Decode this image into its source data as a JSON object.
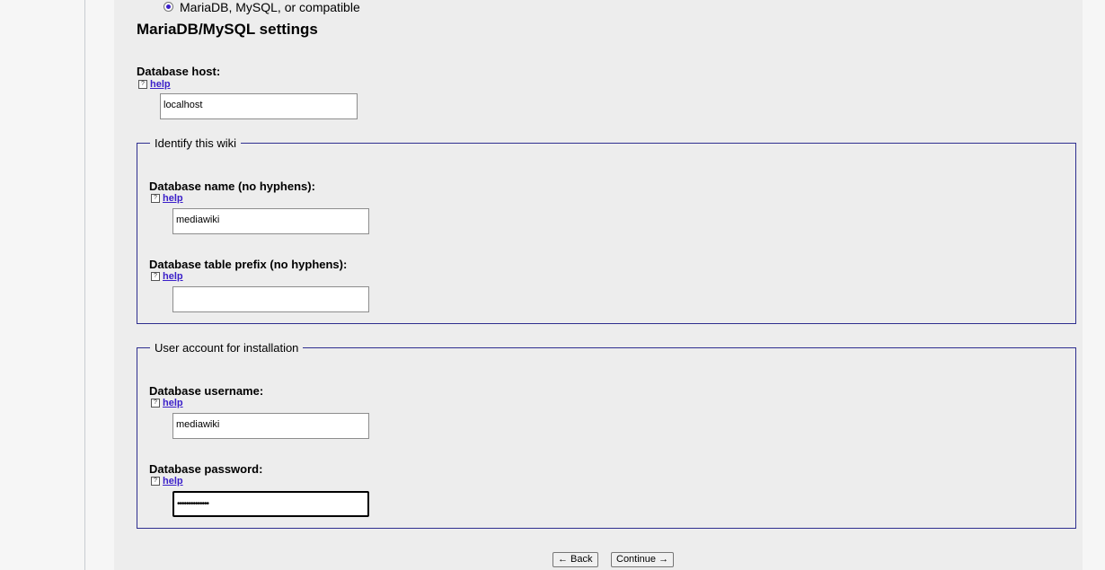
{
  "db_type": {
    "selected_option": "MariaDB, MySQL, or compatible"
  },
  "section_title": "MariaDB/MySQL settings",
  "db_host": {
    "label": "Database host:",
    "help": "help",
    "value": "localhost"
  },
  "identify_wiki": {
    "legend": "Identify this wiki",
    "db_name": {
      "label": "Database name (no hyphens):",
      "help": "help",
      "value": "mediawiki"
    },
    "table_prefix": {
      "label": "Database table prefix (no hyphens):",
      "help": "help",
      "value": ""
    }
  },
  "user_account": {
    "legend": "User account for installation",
    "username": {
      "label": "Database username:",
      "help": "help",
      "value": "mediawiki"
    },
    "password": {
      "label": "Database password:",
      "help": "help",
      "value": "••••••••••••••"
    }
  },
  "buttons": {
    "back": "← Back",
    "continue": "Continue →"
  },
  "icons": {
    "help": "help-icon",
    "radio": "radio-selected-icon"
  },
  "colors": {
    "link": "#3a1fc9",
    "fieldset_border": "#2e2e8f",
    "content_bg": "#ededed"
  }
}
